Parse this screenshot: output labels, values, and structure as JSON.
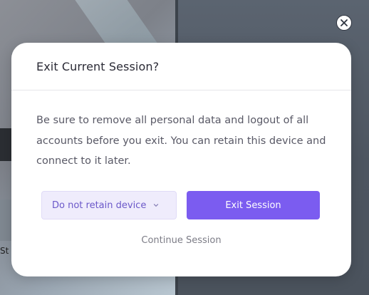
{
  "background": {
    "app_label": "St"
  },
  "close_button": {
    "icon": "close-icon"
  },
  "modal": {
    "title": "Exit Current Session?",
    "message": "Be sure to remove all personal data and logout of all accounts before you exit. You can retain this device and connect to it later.",
    "retain_select": {
      "value": "Do not retain device",
      "icon": "chevron-down-icon"
    },
    "exit_button": "Exit Session",
    "continue_link": "Continue Session"
  },
  "colors": {
    "accent": "#7b5cf0",
    "select_bg": "#efecfc",
    "select_text": "#6b58c9"
  }
}
